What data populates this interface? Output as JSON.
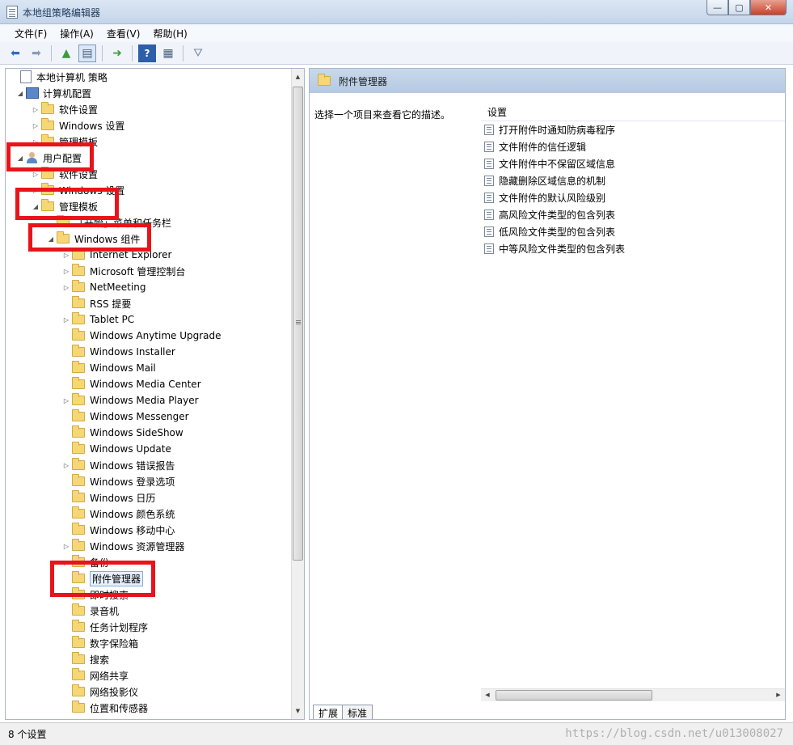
{
  "window": {
    "title": "本地组策略编辑器",
    "controls": [
      "—",
      "▢",
      "✕"
    ]
  },
  "menu": [
    "文件(F)",
    "操作(A)",
    "查看(V)",
    "帮助(H)"
  ],
  "toolbar": {
    "icons": [
      "back-arrow-icon",
      "forward-arrow-icon",
      "up-folder-icon",
      "show-tree-icon",
      "export-icon",
      "help-icon",
      "properties-icon",
      "filter-icon"
    ]
  },
  "tree": [
    {
      "label": "本地计算机 策略",
      "level": 0,
      "arrow": "",
      "icon": "policy"
    },
    {
      "label": "计算机配置",
      "level": 1,
      "arrow": "◢",
      "icon": "computer"
    },
    {
      "label": "软件设置",
      "level": 2,
      "arrow": "▷",
      "icon": "folder"
    },
    {
      "label": "Windows 设置",
      "level": 2,
      "arrow": "▷",
      "icon": "folder"
    },
    {
      "label": "管理模板",
      "level": 2,
      "arrow": "▷",
      "icon": "folder"
    },
    {
      "label": "用户配置",
      "level": 1,
      "arrow": "◢",
      "icon": "user"
    },
    {
      "label": "软件设置",
      "level": 2,
      "arrow": "▷",
      "icon": "folder"
    },
    {
      "label": "Windows 设置",
      "level": 2,
      "arrow": "▷",
      "icon": "folder"
    },
    {
      "label": "管理模板",
      "level": 2,
      "arrow": "◢",
      "icon": "folder"
    },
    {
      "label": "「开始」菜单和任务栏",
      "level": 3,
      "arrow": "",
      "icon": "folder"
    },
    {
      "label": "Windows 组件",
      "level": 3,
      "arrow": "◢",
      "icon": "folder"
    },
    {
      "label": "Internet Explorer",
      "level": 4,
      "arrow": "▷",
      "icon": "folder"
    },
    {
      "label": "Microsoft 管理控制台",
      "level": 4,
      "arrow": "▷",
      "icon": "folder"
    },
    {
      "label": "NetMeeting",
      "level": 4,
      "arrow": "▷",
      "icon": "folder"
    },
    {
      "label": "RSS 提要",
      "level": 4,
      "arrow": "",
      "icon": "folder"
    },
    {
      "label": "Tablet PC",
      "level": 4,
      "arrow": "▷",
      "icon": "folder"
    },
    {
      "label": "Windows Anytime Upgrade",
      "level": 4,
      "arrow": "",
      "icon": "folder"
    },
    {
      "label": "Windows Installer",
      "level": 4,
      "arrow": "",
      "icon": "folder"
    },
    {
      "label": "Windows Mail",
      "level": 4,
      "arrow": "",
      "icon": "folder"
    },
    {
      "label": "Windows Media Center",
      "level": 4,
      "arrow": "",
      "icon": "folder"
    },
    {
      "label": "Windows Media Player",
      "level": 4,
      "arrow": "▷",
      "icon": "folder"
    },
    {
      "label": "Windows Messenger",
      "level": 4,
      "arrow": "",
      "icon": "folder"
    },
    {
      "label": "Windows SideShow",
      "level": 4,
      "arrow": "",
      "icon": "folder"
    },
    {
      "label": "Windows Update",
      "level": 4,
      "arrow": "",
      "icon": "folder"
    },
    {
      "label": "Windows 错误报告",
      "level": 4,
      "arrow": "▷",
      "icon": "folder"
    },
    {
      "label": "Windows 登录选项",
      "level": 4,
      "arrow": "",
      "icon": "folder"
    },
    {
      "label": "Windows 日历",
      "level": 4,
      "arrow": "",
      "icon": "folder"
    },
    {
      "label": "Windows 颜色系统",
      "level": 4,
      "arrow": "",
      "icon": "folder"
    },
    {
      "label": "Windows 移动中心",
      "level": 4,
      "arrow": "",
      "icon": "folder"
    },
    {
      "label": "Windows 资源管理器",
      "level": 4,
      "arrow": "▷",
      "icon": "folder"
    },
    {
      "label": "备份",
      "level": 4,
      "arrow": "▷",
      "icon": "folder"
    },
    {
      "label": "附件管理器",
      "level": 4,
      "arrow": "",
      "icon": "folder",
      "selected": true
    },
    {
      "label": "即时搜索",
      "level": 4,
      "arrow": "",
      "icon": "folder"
    },
    {
      "label": "录音机",
      "level": 4,
      "arrow": "",
      "icon": "folder"
    },
    {
      "label": "任务计划程序",
      "level": 4,
      "arrow": "",
      "icon": "folder"
    },
    {
      "label": "数字保险箱",
      "level": 4,
      "arrow": "",
      "icon": "folder"
    },
    {
      "label": "搜索",
      "level": 4,
      "arrow": "",
      "icon": "folder"
    },
    {
      "label": "网络共享",
      "level": 4,
      "arrow": "",
      "icon": "folder"
    },
    {
      "label": "网络投影仪",
      "level": 4,
      "arrow": "",
      "icon": "folder"
    },
    {
      "label": "位置和传感器",
      "level": 4,
      "arrow": "",
      "icon": "folder"
    }
  ],
  "right": {
    "header_title": "附件管理器",
    "description": "选择一个项目来查看它的描述。",
    "column_header": "设置",
    "settings": [
      "打开附件时通知防病毒程序",
      "文件附件的信任逻辑",
      "文件附件中不保留区域信息",
      "隐藏删除区域信息的机制",
      "文件附件的默认风险级别",
      "高风险文件类型的包含列表",
      "低风险文件类型的包含列表",
      "中等风险文件类型的包含列表"
    ],
    "tabs": [
      "扩展",
      "标准"
    ]
  },
  "status": {
    "count": "8 个设置",
    "watermark": "https://blog.csdn.net/u013008027"
  },
  "colors": {
    "annotation_red": "#e8141a",
    "header_blue": "#b4c9e2"
  }
}
